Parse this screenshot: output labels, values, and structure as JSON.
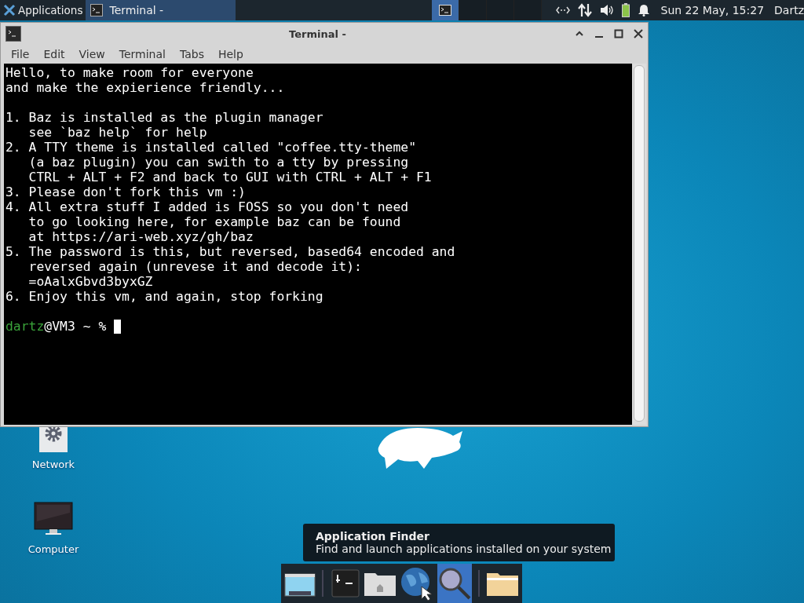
{
  "panel": {
    "menu_label": "Applications",
    "tasks": [
      {
        "title": "Terminal -",
        "selected": true
      }
    ],
    "workspaces": [
      {
        "selected": true
      },
      {
        "selected": false
      },
      {
        "selected": false
      },
      {
        "selected": false
      }
    ],
    "clock": "Sun 22 May, 15:27",
    "user": "Dartz"
  },
  "window": {
    "title": "Terminal -",
    "menu": [
      "File",
      "Edit",
      "View",
      "Terminal",
      "Tabs",
      "Help"
    ],
    "blocks": [
      [
        "Hello, to make room for everyone",
        "and make the expierience friendly..."
      ],
      [
        "1. Baz is installed as the plugin manager",
        "   see `baz help` for help",
        "2. A TTY theme is installed called \"coffee.tty-theme\"",
        "   (a baz plugin) you can swith to a tty by pressing",
        "   CTRL + ALT + F2 and back to GUI with CTRL + ALT + F1",
        "3. Please don't fork this vm :)",
        "4. All extra stuff I added is FOSS so you don't need",
        "   to go looking here, for example baz can be found",
        "   at https://ari-web.xyz/gh/baz",
        "5. The password is this, but reversed, based64 encoded and",
        "   reversed again (unrevese it and decode it):",
        "   =oAalxGbvd3byxGZ",
        "6. Enjoy this vm, and again, stop forking"
      ]
    ],
    "prompt": {
      "user": "dartz",
      "rest": "@VM3 ~ %"
    }
  },
  "desktop_icons": [
    {
      "label": "Network",
      "kind": "network"
    },
    {
      "label": "Computer",
      "kind": "computer"
    }
  ],
  "tooltip": {
    "title": "Application Finder",
    "text": "Find and launch applications installed on your system"
  },
  "dock": [
    {
      "kind": "display",
      "selected": false
    },
    {
      "kind": "separator"
    },
    {
      "kind": "terminal",
      "selected": false
    },
    {
      "kind": "home",
      "selected": false
    },
    {
      "kind": "web",
      "selected": false
    },
    {
      "kind": "search",
      "selected": true
    },
    {
      "kind": "separator"
    },
    {
      "kind": "folder",
      "selected": false
    }
  ]
}
